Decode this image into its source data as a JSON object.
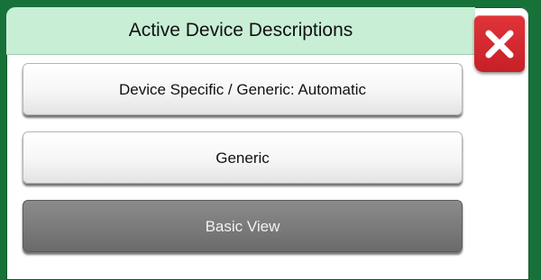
{
  "dialog": {
    "title": "Active Device Descriptions",
    "close_icon": "close-x-icon"
  },
  "options": [
    {
      "label": "Device Specific / Generic: Automatic",
      "selected": false
    },
    {
      "label": "Generic",
      "selected": false
    },
    {
      "label": "Basic View",
      "selected": true
    }
  ],
  "colors": {
    "frame": "#167238",
    "title_bar": "#c8eed6",
    "close_button": "#d42a31",
    "selected_option": "#7a7a7a"
  }
}
